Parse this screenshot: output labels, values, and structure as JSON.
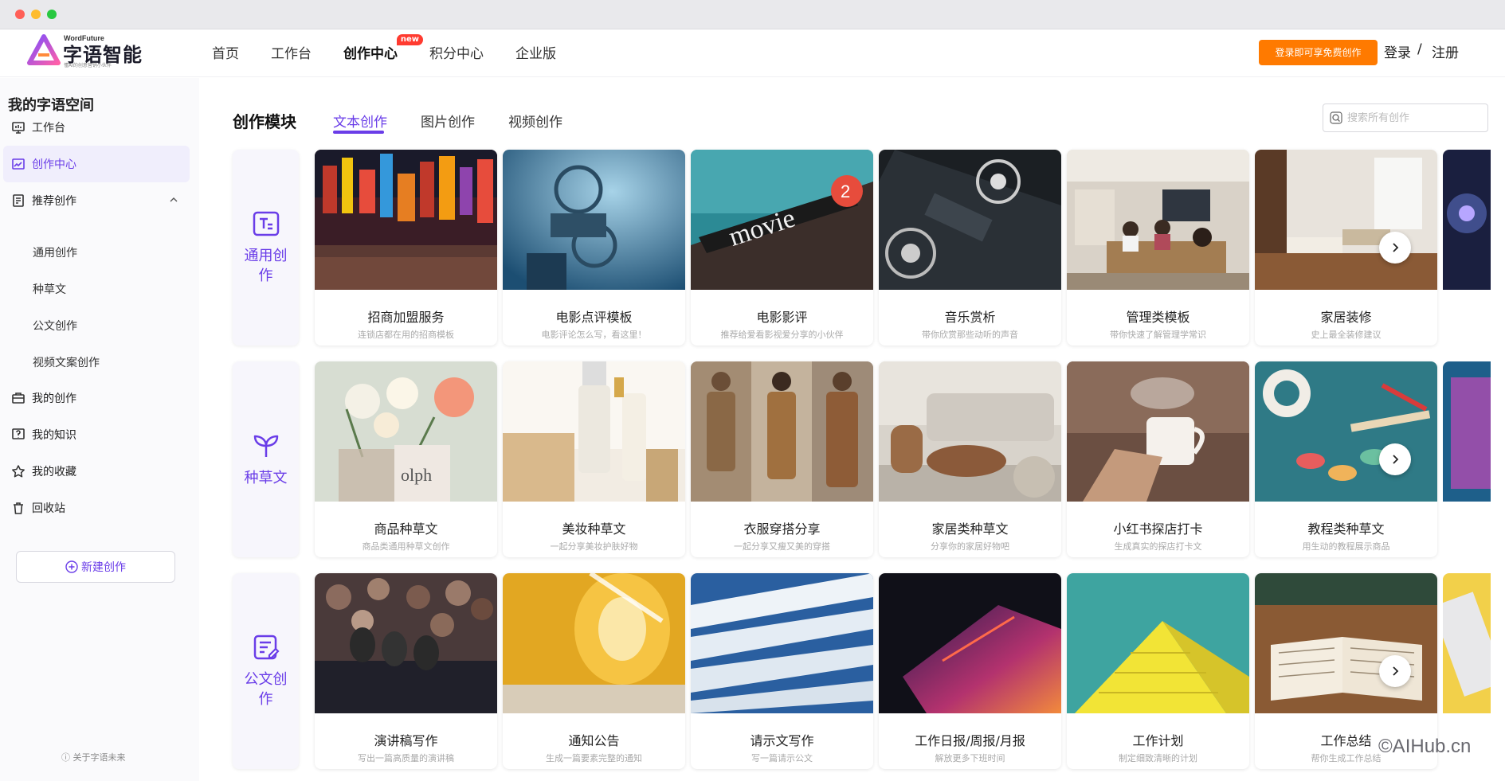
{
  "window": {
    "controls": [
      "close",
      "minimize",
      "maximize"
    ]
  },
  "header": {
    "logo_en": "WordFuture",
    "logo_cn": "字语智能",
    "logo_sub": "懂AI的创意营销小伙伴",
    "nav": [
      {
        "label": "首页"
      },
      {
        "label": "工作台"
      },
      {
        "label": "创作中心",
        "badge": "new",
        "active": true
      },
      {
        "label": "积分中心"
      },
      {
        "label": "企业版"
      }
    ],
    "promo": "登录即可享免费创作",
    "login": "登录",
    "separator": "/",
    "register": "注册"
  },
  "sidebar": {
    "title": "我的字语空间",
    "items": [
      {
        "label": "工作台",
        "icon": "monitor-icon"
      },
      {
        "label": "创作中心",
        "icon": "chart-icon",
        "active": true
      },
      {
        "label": "推荐创作",
        "icon": "document-icon",
        "expanded": true
      },
      {
        "label": "我的创作",
        "icon": "briefcase-icon"
      },
      {
        "label": "我的知识",
        "icon": "question-icon"
      },
      {
        "label": "我的收藏",
        "icon": "star-icon"
      },
      {
        "label": "回收站",
        "icon": "trash-icon"
      }
    ],
    "sub_items": [
      "通用创作",
      "种草文",
      "公文创作",
      "视频文案创作"
    ],
    "new_button": "新建创作",
    "about": "关于字语未来"
  },
  "main": {
    "title": "创作模块",
    "tabs": [
      {
        "label": "文本创作",
        "active": true
      },
      {
        "label": "图片创作"
      },
      {
        "label": "视频创作"
      }
    ],
    "search_placeholder": "搜索所有创作",
    "rows": [
      {
        "category": "通用创作",
        "icon": "text-box-icon",
        "cards": [
          {
            "title": "招商加盟服务",
            "desc": "连锁店都在用的招商模板"
          },
          {
            "title": "电影点评模板",
            "desc": "电影评论怎么写，看这里！"
          },
          {
            "title": "电影影评",
            "desc": "推荐给爱看影视爱分享的小伙伴"
          },
          {
            "title": "音乐赏析",
            "desc": "带你欣赏那些动听的声音"
          },
          {
            "title": "管理类模板",
            "desc": "带你快速了解管理学常识"
          },
          {
            "title": "家居装修",
            "desc": "史上最全装修建议"
          }
        ]
      },
      {
        "category": "种草文",
        "icon": "sprout-icon",
        "cards": [
          {
            "title": "商品种草文",
            "desc": "商品类通用种草文创作"
          },
          {
            "title": "美妆种草文",
            "desc": "一起分享美妆护肤好物"
          },
          {
            "title": "衣服穿搭分享",
            "desc": "一起分享又瘦又美的穿搭"
          },
          {
            "title": "家居类种草文",
            "desc": "分享你的家居好物吧"
          },
          {
            "title": "小红书探店打卡",
            "desc": "生成真实的探店打卡文"
          },
          {
            "title": "教程类种草文",
            "desc": "用生动的教程展示商品"
          }
        ]
      },
      {
        "category": "公文创作",
        "icon": "edit-document-icon",
        "cards": [
          {
            "title": "演讲稿写作",
            "desc": "写出一篇高质量的演讲稿"
          },
          {
            "title": "通知公告",
            "desc": "生成一篇要素完整的通知"
          },
          {
            "title": "请示文写作",
            "desc": "写一篇请示公文"
          },
          {
            "title": "工作日报/周报/月报",
            "desc": "解放更多下班时间"
          },
          {
            "title": "工作计划",
            "desc": "制定细致清晰的计划"
          },
          {
            "title": "工作总结",
            "desc": "帮你生成工作总结"
          }
        ]
      }
    ]
  },
  "watermark": "©AIHub.cn",
  "colors": {
    "accent": "#6a3de8",
    "promo": "#ff7a00",
    "badge": "#ff3b30"
  }
}
